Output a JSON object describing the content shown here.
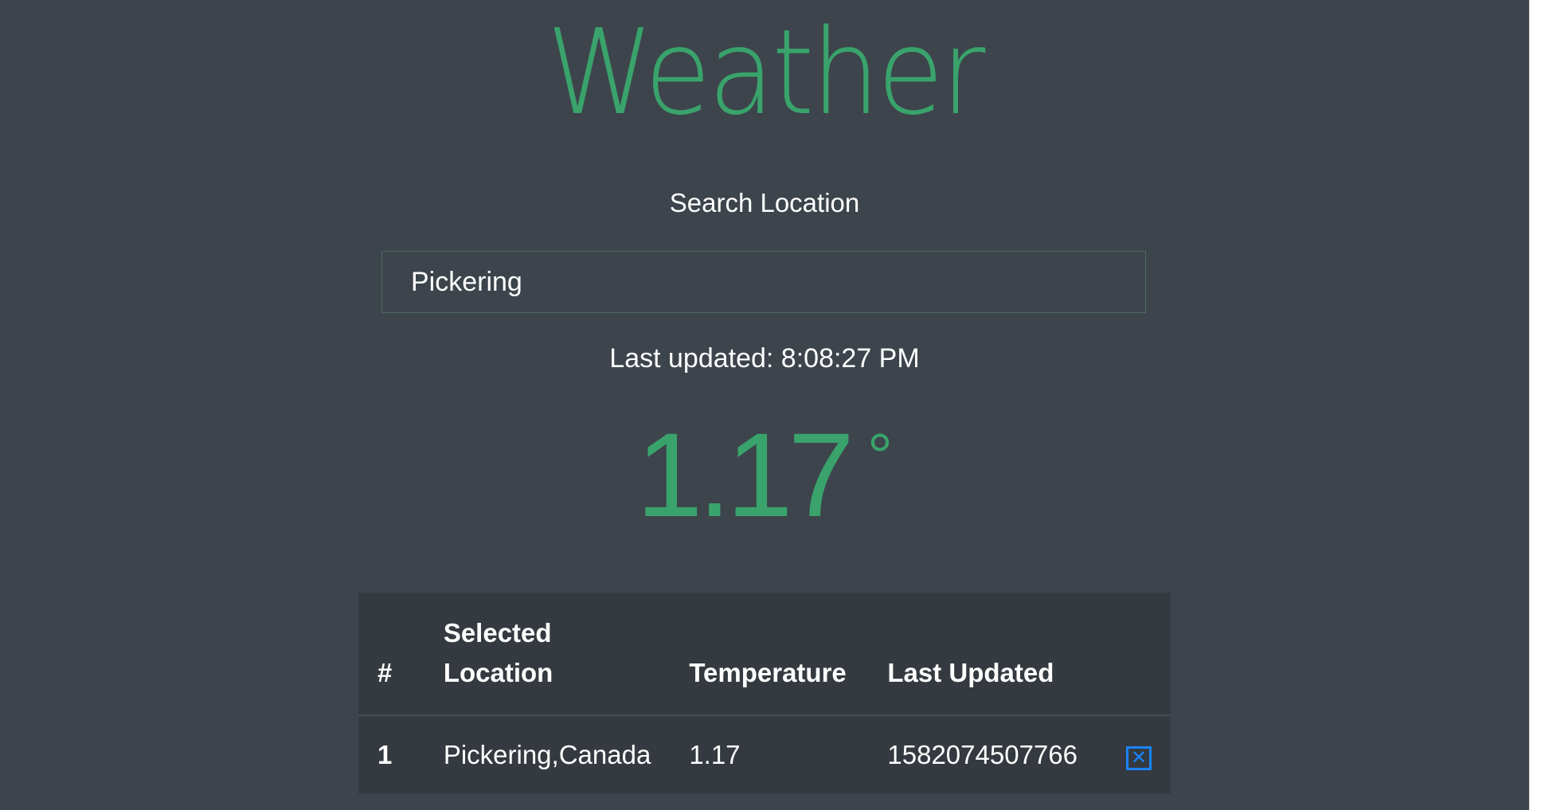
{
  "header": {
    "title": "Weather"
  },
  "search": {
    "label": "Search Location",
    "value": "Pickering",
    "placeholder": ""
  },
  "status": {
    "last_updated": "Last updated: 8:08:27 PM"
  },
  "current": {
    "temperature": "1.17",
    "degree_symbol": "°"
  },
  "table": {
    "headers": {
      "num": "#",
      "location": "Selected Location",
      "temperature": "Temperature",
      "last_updated": "Last Updated"
    },
    "rows": [
      {
        "num": "1",
        "location": "Pickering,Canada",
        "temperature": "1.17",
        "last_updated": "1582074507766",
        "delete_glyph": "✕"
      }
    ]
  },
  "colors": {
    "accent": "#39a36b",
    "background": "#3d444c",
    "table_bg": "#343a40",
    "delete_icon": "#1a84ff"
  },
  "icons": {
    "delete": "close-box-icon"
  }
}
